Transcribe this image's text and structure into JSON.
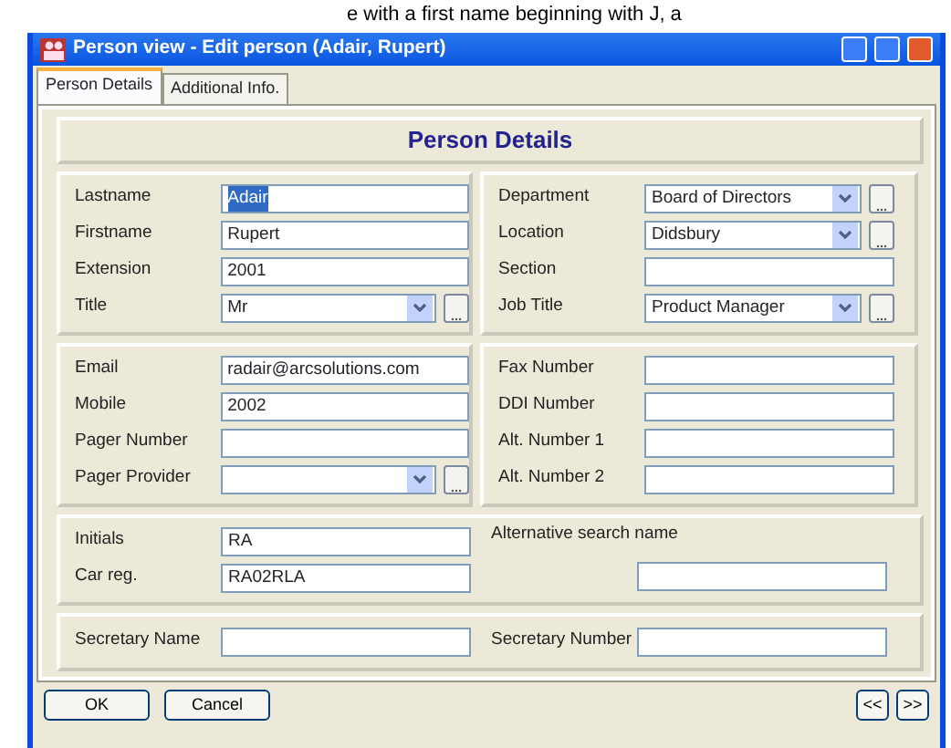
{
  "background_text": "e with a first name beginning with J, a",
  "window": {
    "title": "Person view - Edit person (Adair, Rupert)"
  },
  "tabs": [
    {
      "label": "Person Details",
      "selected": true
    },
    {
      "label": "Additional Info.",
      "selected": false
    }
  ],
  "heading": "Person Details",
  "sections": [
    {
      "left": [
        {
          "kind": "text",
          "label": "Lastname",
          "value": "Adair",
          "selected": true
        },
        {
          "kind": "text",
          "label": "Firstname",
          "value": "Rupert",
          "selected": false
        },
        {
          "kind": "text",
          "label": "Extension",
          "value": "2001",
          "selected": false
        },
        {
          "kind": "combo",
          "label": "Title",
          "value": "Mr",
          "selected": false
        }
      ],
      "right": [
        {
          "kind": "combo",
          "label": "Department",
          "value": "Board of Directors",
          "selected": false
        },
        {
          "kind": "combo",
          "label": "Location",
          "value": "Didsbury",
          "selected": false
        },
        {
          "kind": "text",
          "label": "Section"
        },
        {
          "kind": "combo",
          "label": "Job Title",
          "value": "Product Manager",
          "selected": false
        }
      ]
    },
    {
      "left": [
        {
          "kind": "text",
          "label": "Email",
          "value": "radair@arcsolutions.com",
          "selected": false
        },
        {
          "kind": "text",
          "label": "Mobile",
          "value": "2002",
          "selected": false
        },
        {
          "kind": "text",
          "label": "Pager Number"
        },
        {
          "kind": "combo",
          "label": "Pager Provider"
        }
      ],
      "right": [
        {
          "kind": "text",
          "label": "Fax Number"
        },
        {
          "kind": "text",
          "label": "DDI Number"
        },
        {
          "kind": "text",
          "label": "Alt. Number 1"
        },
        {
          "kind": "text",
          "label": "Alt. Number 2"
        }
      ]
    },
    {
      "left": [
        {
          "kind": "text",
          "label": "Initials",
          "value": "RA",
          "selected": false
        },
        {
          "kind": "text",
          "label": "Car reg.",
          "value": "RA02RLA",
          "selected": false
        }
      ],
      "right": [
        {
          "kind": "stacked",
          "label": "Alternative search name"
        }
      ]
    },
    {
      "left": [
        {
          "kind": "text",
          "label": "Secretary Name"
        }
      ],
      "right": [
        {
          "kind": "text",
          "label": "Secretary Number"
        }
      ]
    }
  ],
  "buttons": [
    "OK",
    "Cancel"
  ],
  "nav_buttons": [
    "<<",
    ">>"
  ]
}
